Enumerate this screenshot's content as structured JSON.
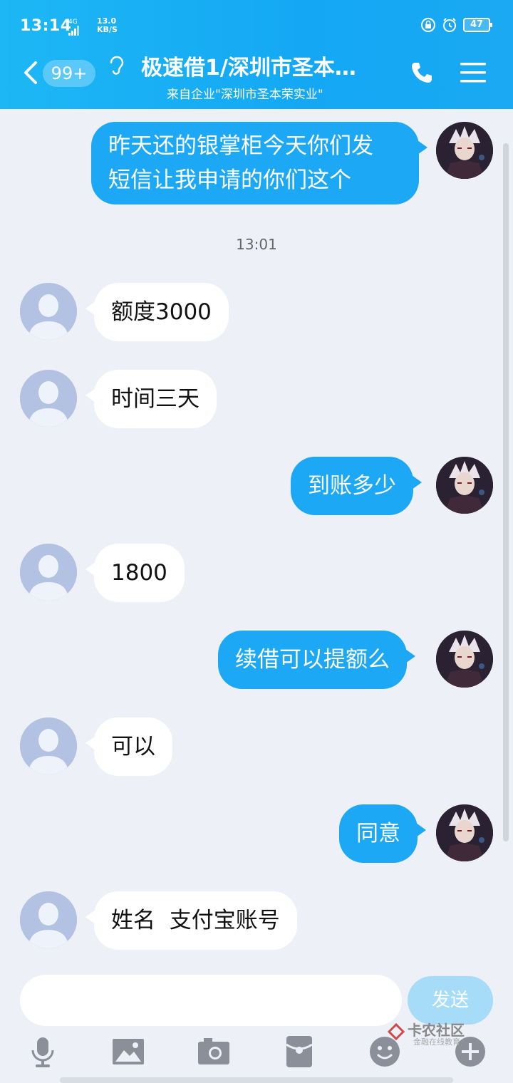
{
  "status_bar": {
    "time": "13:14",
    "network": "4G",
    "speed_value": "13.0",
    "speed_unit": "KB/S",
    "battery": "47"
  },
  "header": {
    "unread_count": "99+",
    "title": "极速借1/深圳市圣本…",
    "subtitle": "来自企业\"深圳市圣本荣实业\""
  },
  "chat": {
    "timestamp": "13:01",
    "messages": [
      {
        "from": "me",
        "text_line1": "昨天还的银掌柜今天你们发",
        "text_line2": "短信让我申请的你们这个"
      },
      {
        "from": "other",
        "text": "额度3000"
      },
      {
        "from": "other",
        "text": "时间三天"
      },
      {
        "from": "me",
        "text": "到账多少"
      },
      {
        "from": "other",
        "text": "1800"
      },
      {
        "from": "me",
        "text": "续借可以提额么"
      },
      {
        "from": "other",
        "text": "可以"
      },
      {
        "from": "me",
        "text": "同意"
      },
      {
        "from": "other",
        "text": "姓名  支付宝账号"
      }
    ]
  },
  "input": {
    "value": "",
    "send_label": "发送"
  },
  "watermark": {
    "line1": "卡农社区",
    "line2": "金融在线教育"
  },
  "colors": {
    "accent": "#1ca8f4",
    "background": "#edf0f6",
    "incoming_bubble": "#ffffff",
    "default_avatar": "#b3c1e3"
  }
}
